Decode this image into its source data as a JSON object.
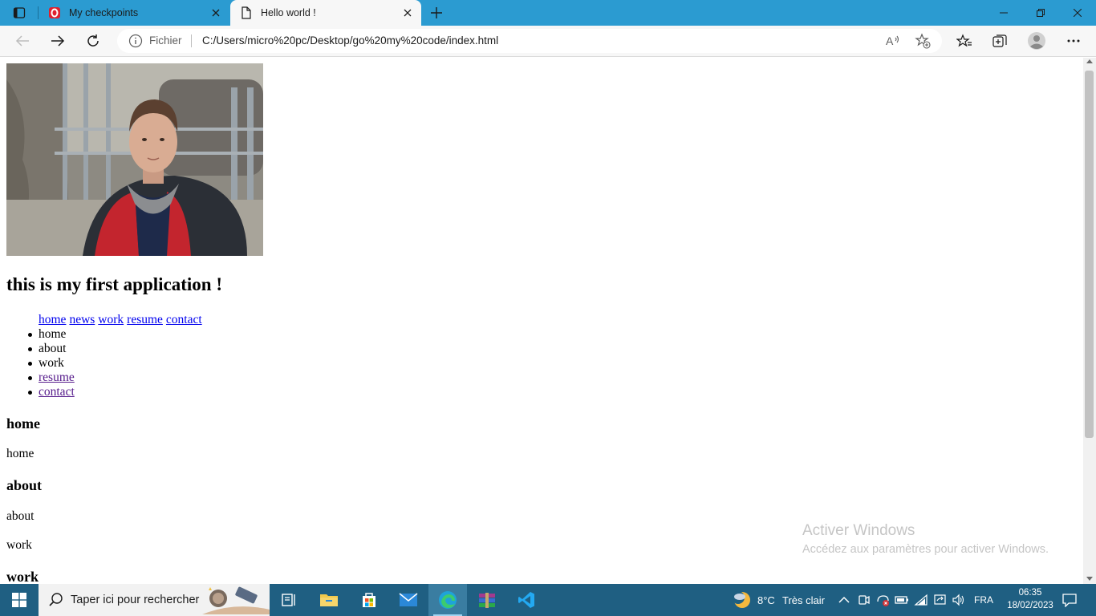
{
  "browser": {
    "tabs": [
      {
        "title": "My checkpoints",
        "active": false
      },
      {
        "title": "Hello world !",
        "active": true
      }
    ],
    "address": {
      "scheme_label": "Fichier",
      "url": "C:/Users/micro%20pc/Desktop/go%20my%20code/index.html"
    }
  },
  "page": {
    "heading": "this is my first application !",
    "nav_links": [
      "home",
      "news",
      "work",
      "resume",
      "contact"
    ],
    "list_items": [
      {
        "text": "home",
        "link": false
      },
      {
        "text": "about",
        "link": false
      },
      {
        "text": "work",
        "link": false
      },
      {
        "text": "resume",
        "link": true
      },
      {
        "text": "contact",
        "link": true
      }
    ],
    "sections": {
      "home_heading": "home",
      "home_text": "home",
      "about_heading": "about",
      "about_text": "about",
      "work_text": "work",
      "work_heading": "work"
    }
  },
  "watermark": {
    "title": "Activer Windows",
    "subtitle": "Accédez aux paramètres pour activer Windows."
  },
  "taskbar": {
    "search_placeholder": "Taper ici pour rechercher",
    "weather_temp": "8°C",
    "weather_condition": "Très clair",
    "language": "FRA",
    "time": "06:35",
    "date": "18/02/2023"
  },
  "colors": {
    "titlebar": "#2b9bd1",
    "taskbar": "#1f5f82",
    "link": "#0000ee",
    "visited_link": "#551a8b"
  }
}
